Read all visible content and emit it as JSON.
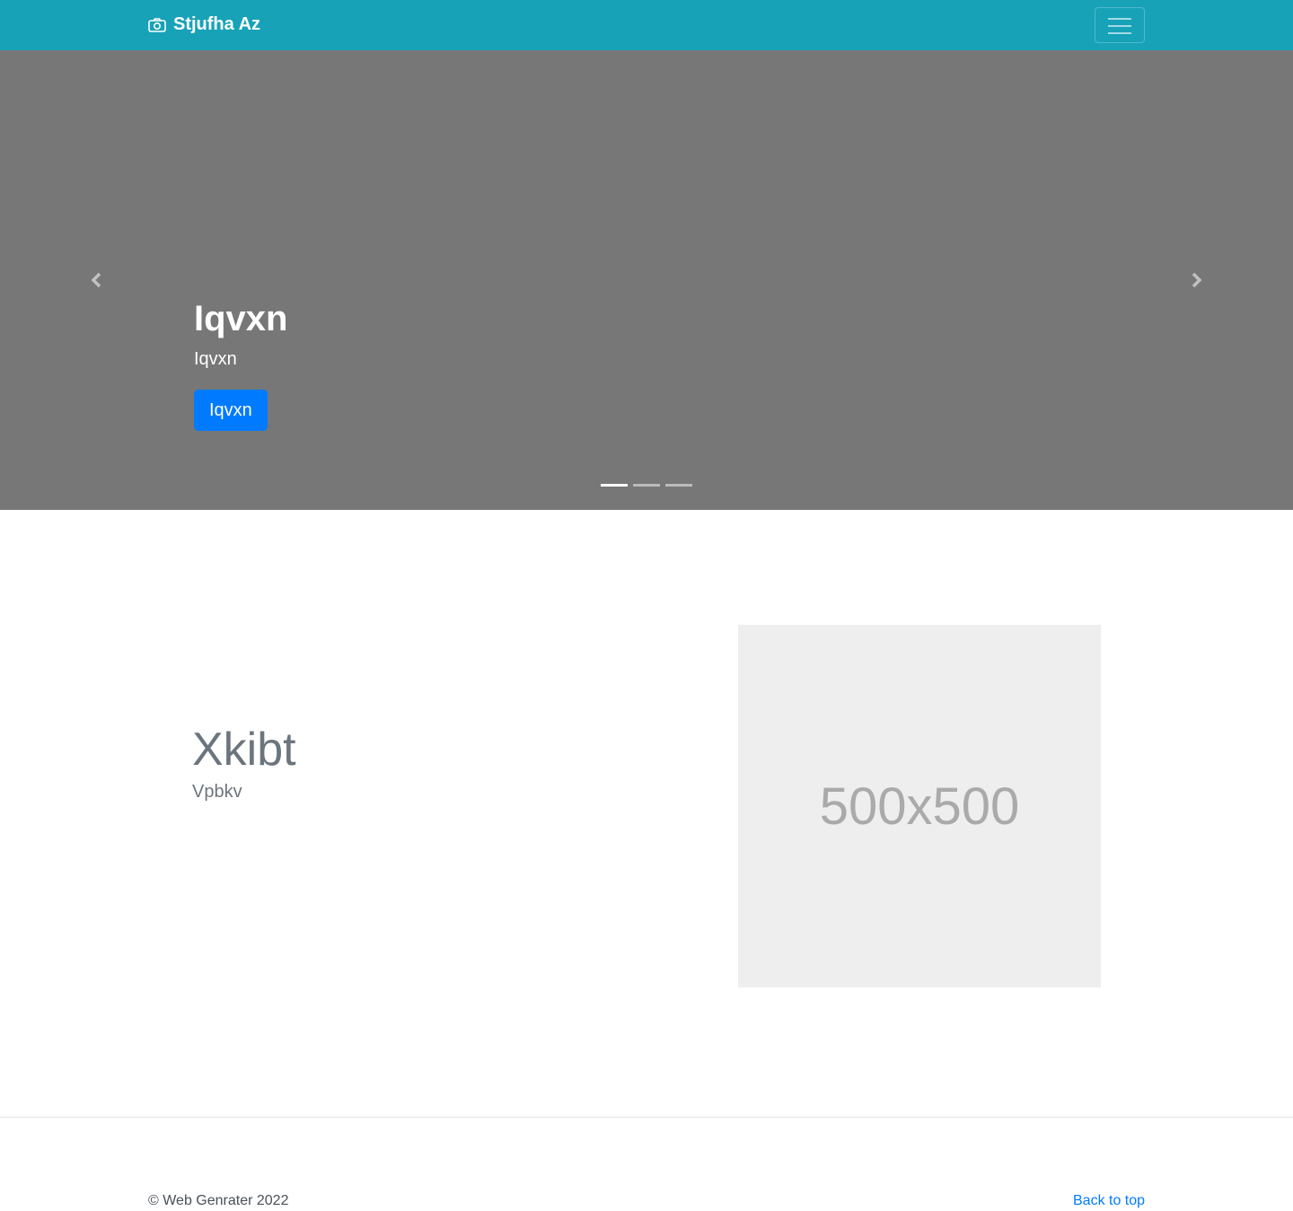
{
  "navbar": {
    "brand_text": "Stjufha Az",
    "brand_icon": "camera-icon",
    "toggler_icon": "hamburger-icon",
    "background_color": "#17a2b8"
  },
  "carousel": {
    "background_color": "#777777",
    "heading": "Iqvxn",
    "subtext": "Iqvxn",
    "button_label": "Iqvxn",
    "button_color": "#007bff",
    "prev_icon": "chevron-left-icon",
    "next_icon": "chevron-right-icon",
    "slide_count": 3,
    "active_slide": 1
  },
  "feature": {
    "title": "Xkibt",
    "subtitle": "Vpbkv",
    "image_label": "500x500"
  },
  "footer": {
    "copyright": "© Web Genrater 2022",
    "back_to_top": "Back to top"
  }
}
